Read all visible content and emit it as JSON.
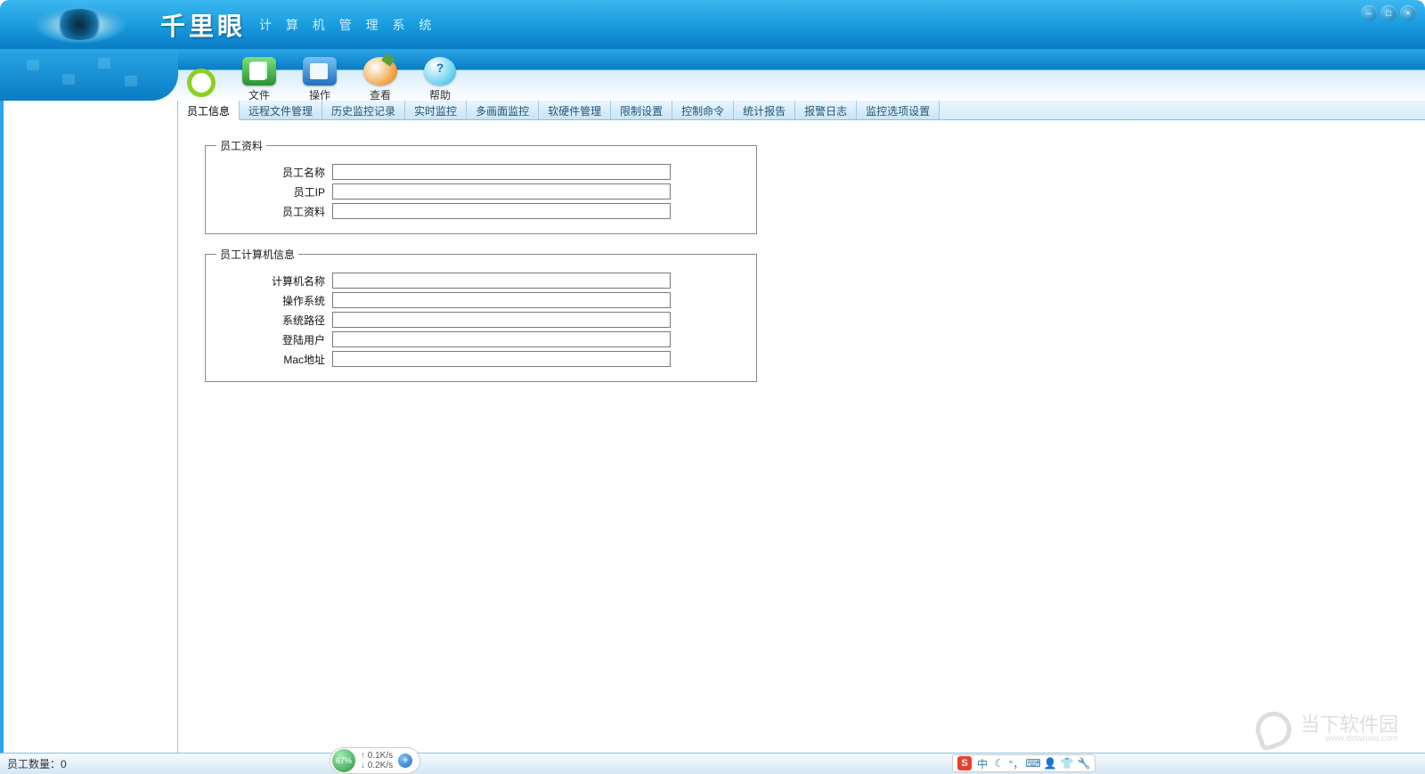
{
  "header": {
    "brand": "千里眼",
    "subtitle": "计 算 机 管 理 系 统"
  },
  "menu": {
    "file": "文件",
    "operate": "操作",
    "view": "查看",
    "help": "帮助"
  },
  "tabs": [
    "员工信息",
    "远程文件管理",
    "历史监控记录",
    "实时监控",
    "多画面监控",
    "软硬件管理",
    "限制设置",
    "控制命令",
    "统计报告",
    "报警日志",
    "监控选项设置"
  ],
  "group1": {
    "legend": "员工资料",
    "rows": {
      "name_label": "员工名称",
      "name_value": "",
      "ip_label": "员工IP",
      "ip_value": "",
      "data_label": "员工资料",
      "data_value": ""
    }
  },
  "group2": {
    "legend": "员工计算机信息",
    "rows": {
      "pcname_label": "计算机名称",
      "pcname_value": "",
      "os_label": "操作系统",
      "os_value": "",
      "syspath_label": "系统路径",
      "syspath_value": "",
      "loginuser_label": "登陆用户",
      "loginuser_value": "",
      "mac_label": "Mac地址",
      "mac_value": ""
    }
  },
  "status": {
    "employee_count_label": "员工数量：",
    "employee_count_value": "0"
  },
  "net": {
    "pct": "67%",
    "up": "0.1K/s",
    "down": "0.2K/s"
  },
  "ime": {
    "lang": "中"
  },
  "watermark": {
    "text": "当下软件园",
    "sub": "www.downxia.com"
  }
}
